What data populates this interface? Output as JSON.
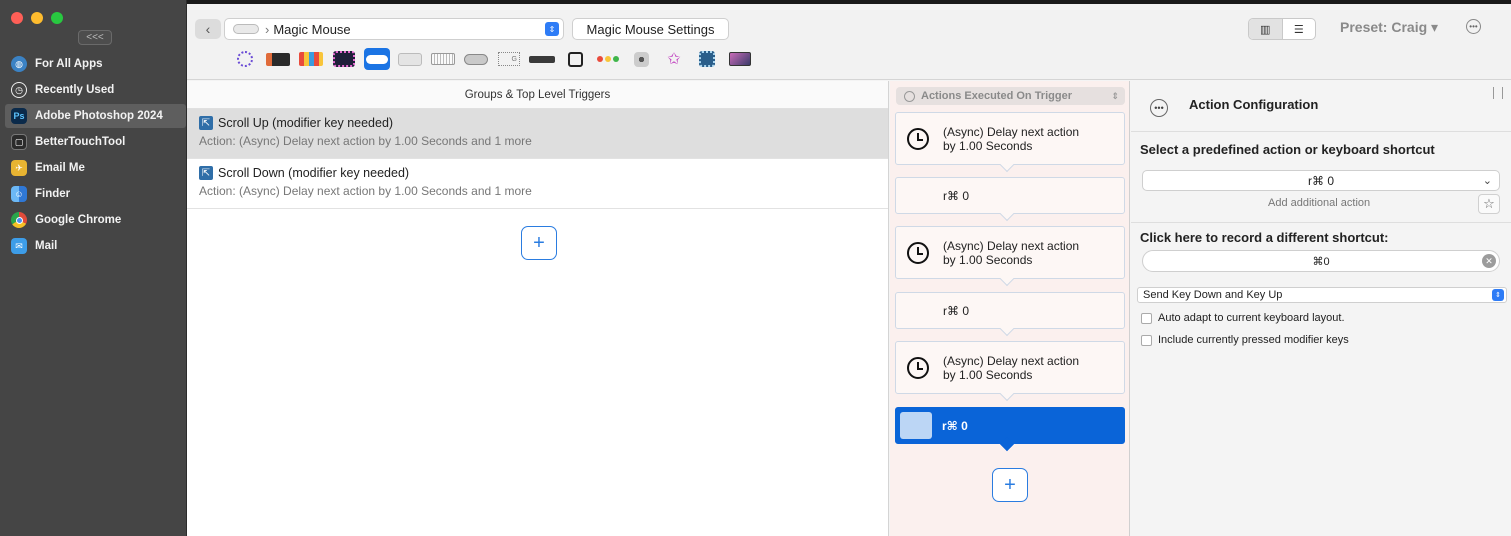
{
  "sidebar": {
    "collapse_label": "<<<",
    "items": [
      {
        "label": "For All Apps",
        "icon": "globe-icon",
        "color": "#3b82c4"
      },
      {
        "label": "Recently Used",
        "icon": "clock-icon",
        "color": "#555555"
      },
      {
        "label": "Adobe Photoshop 2024",
        "icon": "photoshop-icon",
        "color": "#0b2a4a",
        "glyph": "Ps"
      },
      {
        "label": "BetterTouchTool",
        "icon": "bettertouchtool-icon",
        "color": "#3a3a3a"
      },
      {
        "label": "Email Me",
        "icon": "email-me-icon",
        "color": "#e8b432"
      },
      {
        "label": "Finder",
        "icon": "finder-icon",
        "color": "#3d8ae0"
      },
      {
        "label": "Google Chrome",
        "icon": "chrome-icon",
        "color": "#e04b3b"
      },
      {
        "label": "Mail",
        "icon": "mail-icon",
        "color": "#3d9de8"
      }
    ]
  },
  "header": {
    "device_name": "Magic Mouse",
    "device_prefix": "›",
    "settings_label": "Magic Mouse Settings",
    "preset_label": "Preset: Craig ▾",
    "more_glyph": "•••"
  },
  "triggers": {
    "title": "Groups & Top Level Triggers",
    "rows": [
      {
        "name": "Scroll Up (modifier key needed)",
        "desc": "Action: (Async) Delay next action by 1.00 Seconds and 1 more"
      },
      {
        "name": "Scroll Down (modifier key needed)",
        "desc": "Action: (Async) Delay next action by 1.00 Seconds and 1 more"
      }
    ],
    "add_label": "+"
  },
  "actions": {
    "header": "Actions Executed On Trigger",
    "cards": [
      {
        "line1": "(Async) Delay next action",
        "line2": "by 1.00 Seconds"
      },
      {
        "line1": "r⌘  0"
      },
      {
        "line1": "(Async) Delay next action",
        "line2": "by 1.00 Seconds"
      },
      {
        "line1": "r⌘  0"
      },
      {
        "line1": "(Async) Delay next action",
        "line2": "by 1.00 Seconds"
      },
      {
        "line1": "r⌘  0"
      }
    ],
    "add_label": "+"
  },
  "config": {
    "title": "Action Configuration",
    "select_label": "Select a predefined action or keyboard shortcut",
    "predefined_value": "r⌘  0",
    "add_additional": "Add additional action",
    "record_label": "Click here to record a different shortcut:",
    "shortcut_value": "⌘0",
    "send_mode": "Send Key Down and Key Up",
    "auto_adapt": "Auto adapt to current keyboard layout.",
    "include_modifiers": "Include currently pressed modifier keys"
  },
  "colors": {
    "accent": "#0a64d8",
    "close": "#fe5f57",
    "minimize": "#febc2e",
    "maximize": "#28c840"
  }
}
